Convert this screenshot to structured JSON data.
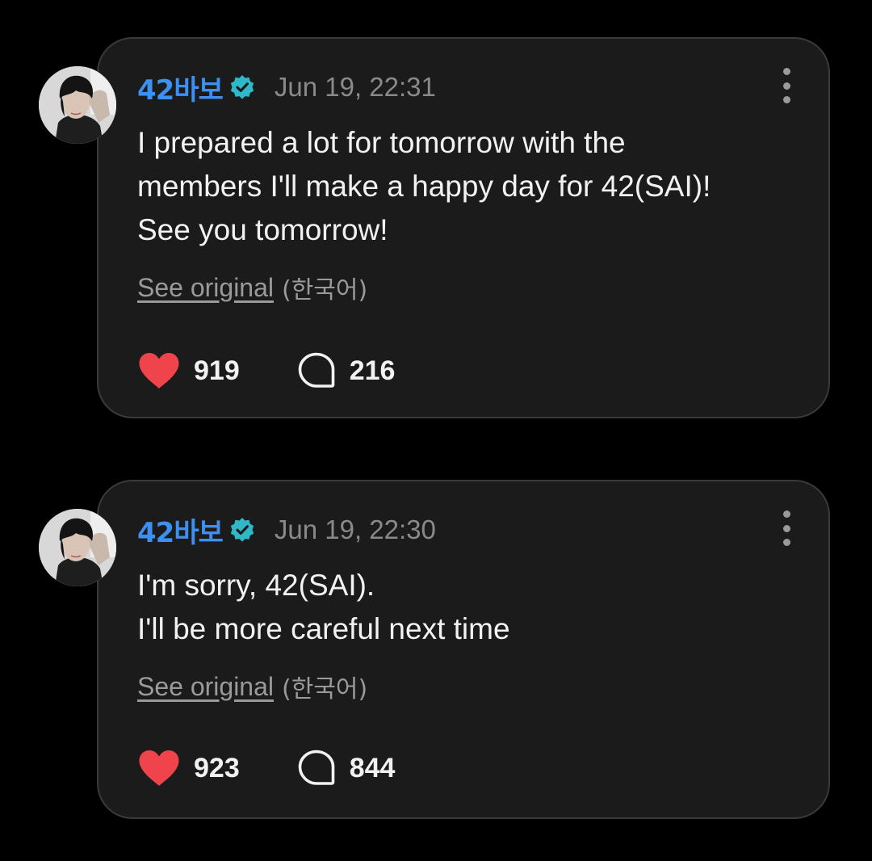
{
  "colors": {
    "background": "#000000",
    "card": "#1b1b1b",
    "username": "#3d8ff0",
    "verified": "#2fb8c8",
    "heart": "#f0444c",
    "muted": "#8a8a8a"
  },
  "icons": {
    "verified": "verified-badge-icon",
    "like": "heart-icon",
    "comment": "comment-bubble-icon",
    "more": "more-vertical-icon"
  },
  "posts": [
    {
      "username": "42바보",
      "timestamp": "Jun 19, 22:31",
      "text": "I prepared a lot for tomorrow with the\nmembers I'll make a happy day for 42(SAI)!\nSee you tomorrow!",
      "see_original": "See original",
      "language": "(한국어)",
      "likes": "919",
      "comments": "216"
    },
    {
      "username": "42바보",
      "timestamp": "Jun 19, 22:30",
      "text": "I'm sorry, 42(SAI).\nI'll be more careful next time",
      "see_original": "See original",
      "language": "(한국어)",
      "likes": "923",
      "comments": "844"
    }
  ]
}
